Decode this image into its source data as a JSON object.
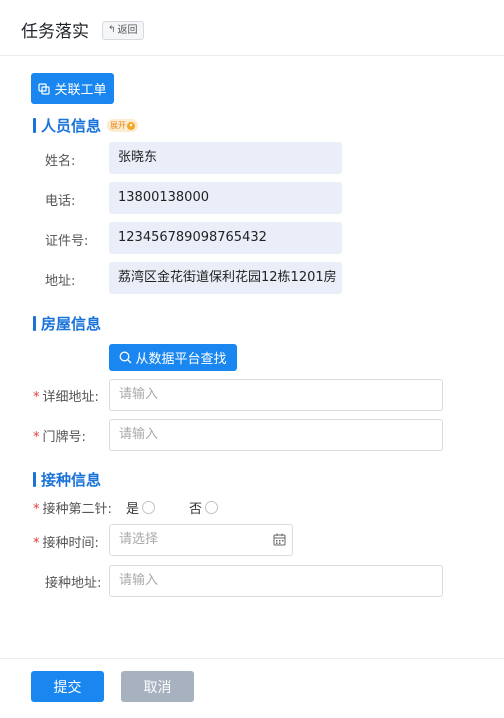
{
  "header": {
    "title": "任务落实",
    "back_label": "返回"
  },
  "toolbar": {
    "relate_label": "关联工单"
  },
  "personal": {
    "title": "人员信息",
    "expand_label": "展开",
    "fields": [
      {
        "label": "姓名:",
        "value": "张晓东"
      },
      {
        "label": "电话:",
        "value": "13800138000"
      },
      {
        "label": "证件号:",
        "value": "123456789098765432"
      },
      {
        "label": "地址:",
        "value": "荔湾区金花街道保利花园12栋1201房"
      }
    ]
  },
  "house": {
    "title": "房屋信息",
    "search_label": "从数据平台查找",
    "address_label": "详细地址:",
    "address_placeholder": "请输入",
    "door_label": "门牌号:",
    "door_placeholder": "请输入"
  },
  "vaccine": {
    "title": "接种信息",
    "second_dose_label": "接种第二针:",
    "option_yes": "是",
    "option_no": "否",
    "time_label": "接种时间:",
    "time_placeholder": "请选择",
    "place_label": "接种地址:",
    "place_placeholder": "请输入"
  },
  "footer": {
    "submit_label": "提交",
    "cancel_label": "取消"
  },
  "colors": {
    "primary": "#1a87f0",
    "section": "#1a73d9",
    "required": "#e03b3b",
    "cancel": "#a7b1bf"
  }
}
